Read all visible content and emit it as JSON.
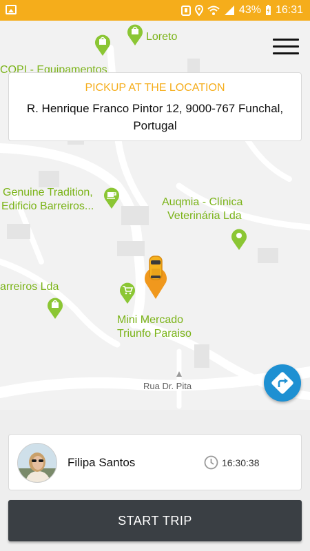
{
  "status_bar": {
    "battery": "43%",
    "time": "16:31",
    "icons": [
      "gallery-icon",
      "nfc-icon",
      "location-icon",
      "wifi-icon",
      "signal-icon",
      "battery-charging-icon"
    ]
  },
  "map": {
    "poi": [
      {
        "label": "Loreto",
        "icon": "shopping-bag-icon"
      },
      {
        "label": "COPI - Equipamentos",
        "icon": "shopping-bag-icon"
      },
      {
        "label": "Genuine Tradition,",
        "label2": "Edificio Barreiros...",
        "icon": "cafe-icon"
      },
      {
        "label": "Auqmia - Clínica",
        "label2": "Veterinária Lda",
        "icon": "map-pin-icon"
      },
      {
        "label": "arreiros Lda",
        "icon": "shopping-bag-icon"
      },
      {
        "label": "Mini Mercado",
        "label2": "Triunfo Paraiso",
        "icon": "shopping-cart-icon"
      }
    ],
    "street": "Rua Dr. Pita"
  },
  "pickup": {
    "title": "PICKUP AT THE LOCATION",
    "address": "R. Henrique Franco Pintor 12, 9000-767 Funchal, Portugal"
  },
  "rider": {
    "name": "Filipa Santos",
    "time": "16:30:38"
  },
  "actions": {
    "start_trip": "START TRIP"
  },
  "colors": {
    "accent": "#f5ad1b",
    "poi_green": "#7ab317",
    "nav_blue": "#1e90d2",
    "button_dark": "#3a3f44"
  }
}
